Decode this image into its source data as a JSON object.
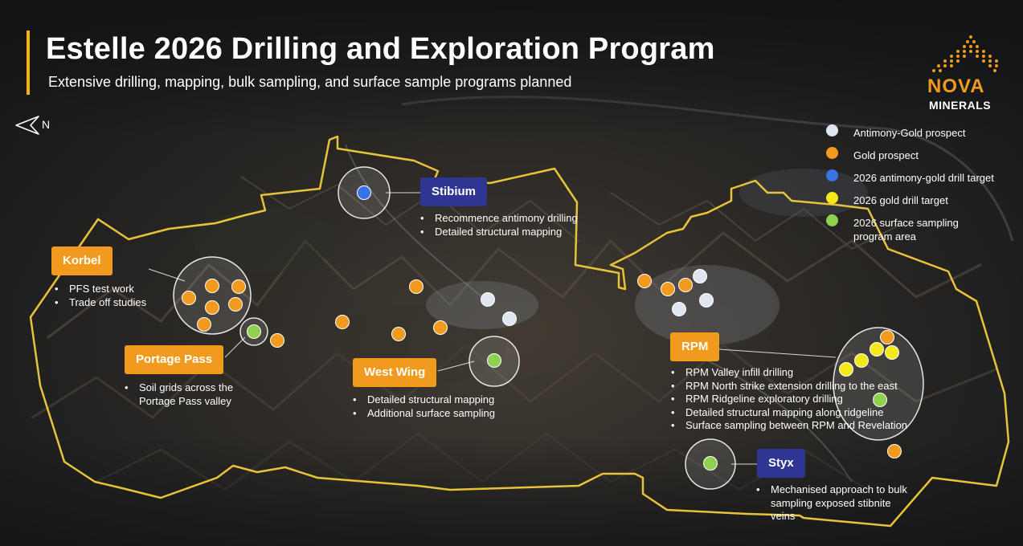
{
  "title": "Estelle 2026 Drilling and Exploration Program",
  "subtitle": "Extensive drilling, mapping, bulk sampling, and surface sample programs planned",
  "north_label": "N",
  "logo": {
    "word1": "NOVA",
    "word2": "MINERALS"
  },
  "colors": {
    "accent": "#f5b400",
    "antimony_gold_prospect": "#dfe6f2",
    "gold_prospect": "#f29a1e",
    "antimony_gold_drill_target": "#3a72e8",
    "gold_drill_target": "#f3e81a",
    "surface_sampling": "#8fd14f",
    "label_orange": "#f29a1e",
    "label_blue": "#2f3592"
  },
  "legend": [
    {
      "label": "Antimony-Gold prospect",
      "color_key": "antimony_gold_prospect"
    },
    {
      "label": "Gold prospect",
      "color_key": "gold_prospect"
    },
    {
      "label": "2026 antimony-gold drill target",
      "color_key": "antimony_gold_drill_target"
    },
    {
      "label": "2026 gold drill target",
      "color_key": "gold_drill_target"
    },
    {
      "label": "2026 surface sampling program area",
      "color_key": "surface_sampling"
    }
  ],
  "prospects": {
    "korbel": {
      "name": "Korbel",
      "bullets": [
        "PFS test work",
        "Trade off studies"
      ]
    },
    "portage_pass": {
      "name": "Portage Pass",
      "bullets": [
        "Soil grids across the Portage Pass valley"
      ]
    },
    "stibium": {
      "name": "Stibium",
      "bullets": [
        "Recommence antimony drilling",
        "Detailed structural mapping"
      ]
    },
    "west_wing": {
      "name": "West Wing",
      "bullets": [
        "Detailed structural mapping",
        "Additional surface sampling"
      ]
    },
    "rpm": {
      "name": "RPM",
      "bullets": [
        "RPM Valley infill drilling",
        "RPM North strike extension drilling to the east",
        "RPM Ridgeline exploratory drilling",
        "Detailed structural mapping along ridgeline",
        "Surface sampling between RPM and Revelation"
      ]
    },
    "styx": {
      "name": "Styx",
      "bullets": [
        "Mechanised approach to bulk sampling exposed stibnite veins"
      ]
    }
  }
}
